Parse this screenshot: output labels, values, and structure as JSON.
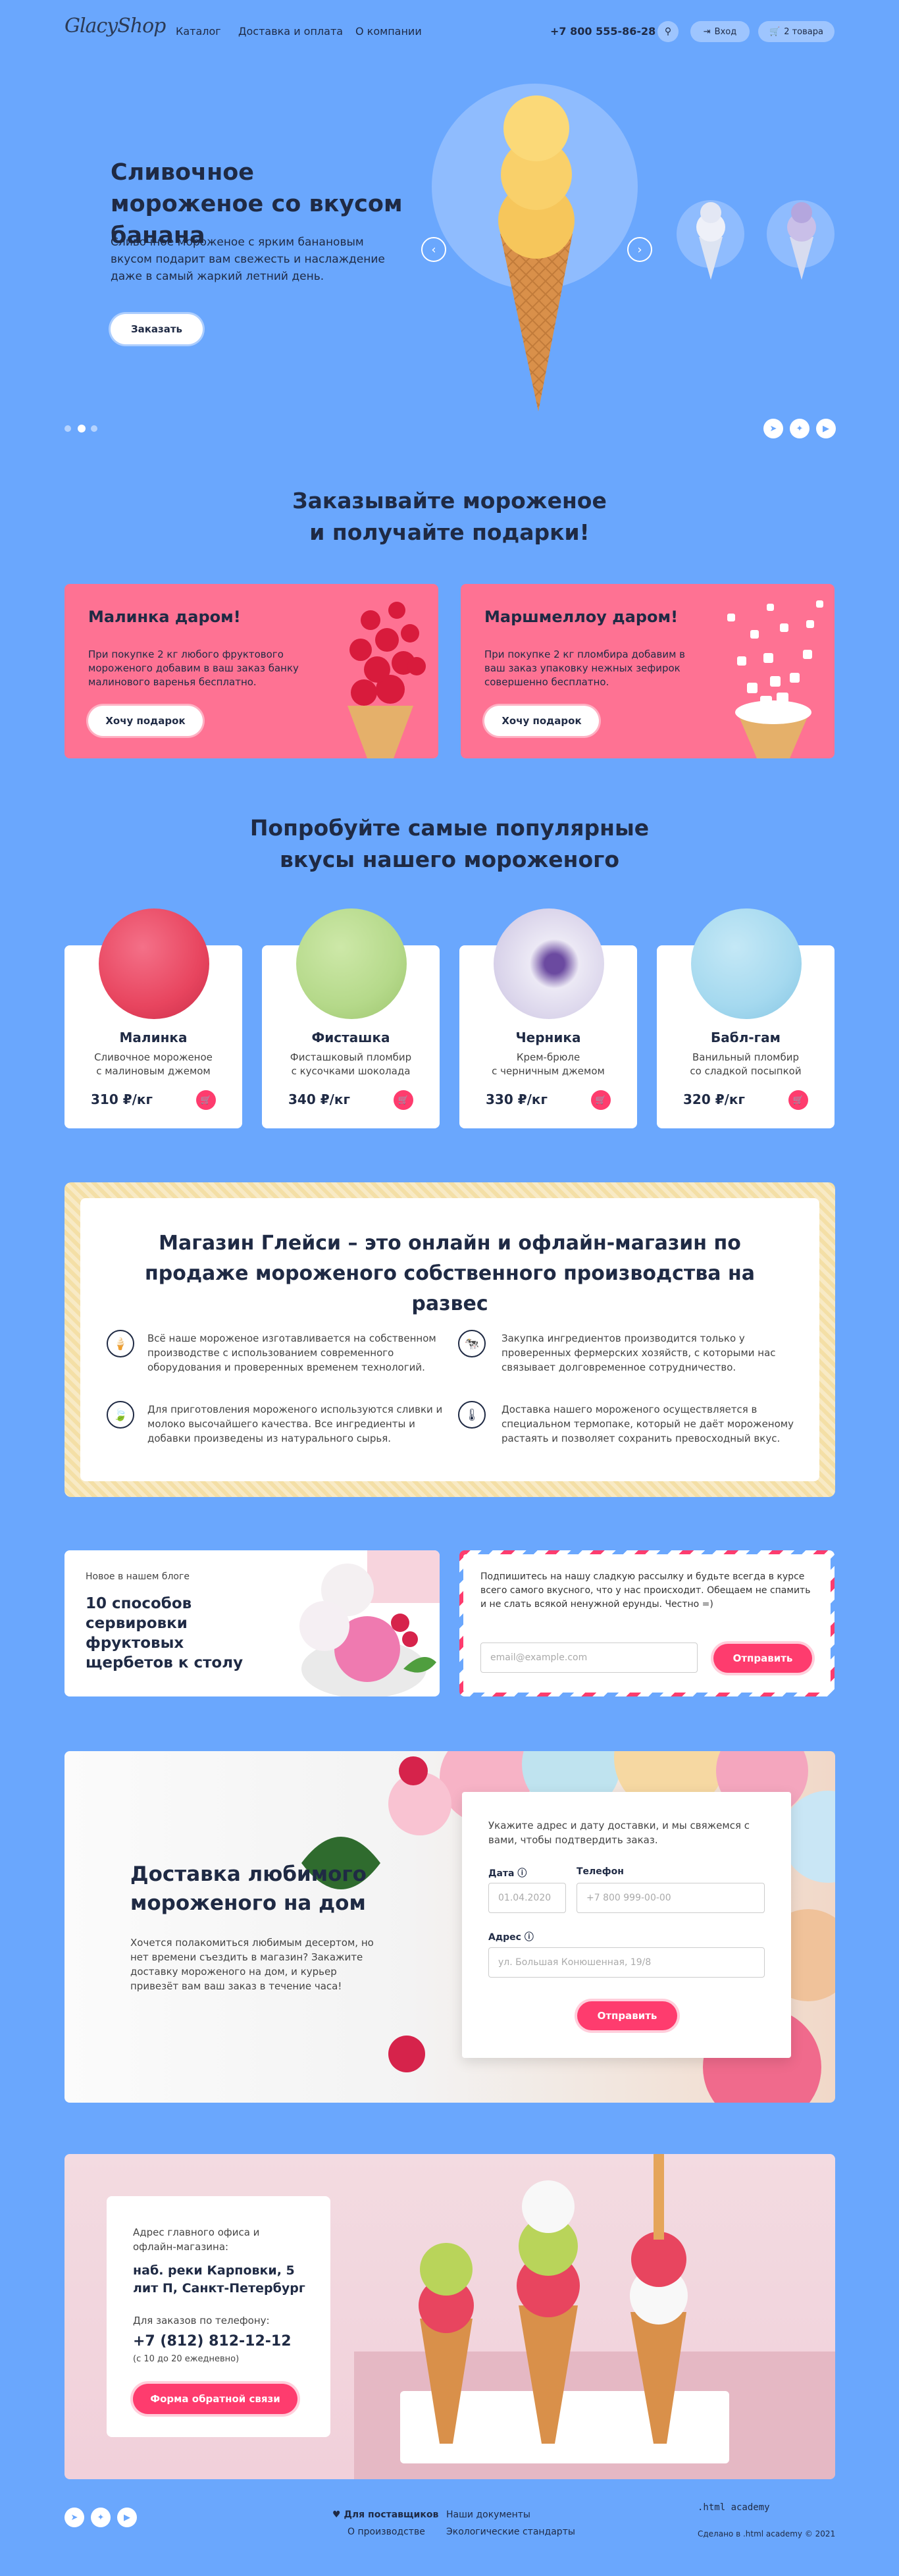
{
  "header": {
    "logo": "GlacyShop",
    "nav": [
      "Каталог",
      "Доставка и оплата",
      "О компании"
    ],
    "phone": "+7 800 555-86-28",
    "login": "Вход",
    "cart": "2 товара"
  },
  "hero": {
    "title": "Сливочное мороженое со вкусом банана",
    "text": "Сливочное мороженое с ярким банановым вкусом подарит вам свежесть и наслаждение даже в самый жаркий летний день.",
    "button": "Заказать",
    "slides_total": 3,
    "slide_active": 2
  },
  "gifts": {
    "title": "Заказывайте мороженое\nи получайте подарки!",
    "items": [
      {
        "title": "Малинка даром!",
        "text": "При покупке 2 кг любого фруктового мороженого добавим в ваш заказ банку малинового варенья бесплатно.",
        "button": "Хочу подарок"
      },
      {
        "title": "Маршмеллоу даром!",
        "text": "При покупке 2 кг пломбира добавим в ваш заказ упаковку нежных зефирок совершенно бесплатно.",
        "button": "Хочу подарок"
      }
    ]
  },
  "popular": {
    "title": "Попробуйте самые популярные\nвкусы нашего мороженого",
    "items": [
      {
        "name": "Малинка",
        "desc": "Сливочное мороженое\nс малиновым джемом",
        "price": "310 ₽/кг",
        "color": "#e8455f"
      },
      {
        "name": "Фисташка",
        "desc": "Фисташковый пломбир\nс кусочками шоколада",
        "price": "340 ₽/кг",
        "color": "#b5d98a"
      },
      {
        "name": "Черника",
        "desc": "Крем-брюле\nс черничным джемом",
        "price": "330 ₽/кг",
        "color": "#ece9f5"
      },
      {
        "name": "Бабл-гам",
        "desc": "Ванильный пломбир\nсо сладкой посыпкой",
        "price": "320 ₽/кг",
        "color": "#a5d9ef"
      }
    ]
  },
  "about": {
    "title": "Магазин Глейси – это онлайн и офлайн-магазин по продаже мороженого собственного производства на развес",
    "features": [
      "Всё наше мороженое изготавливается на собственном производстве с использованием современного оборудования и проверенных временем технологий.",
      "Закупка ингредиентов производится только у проверенных фермерских хозяйств, с которыми нас связывает долговременное сотрудничество.",
      "Для приготовления мороженого используются сливки и молоко высочайшего качества. Все ингредиенты и добавки произведены из натурального сырья.",
      "Доставка нашего мороженого осуществляется в специальном термопаке, который не даёт мороженому растаять и позволяет сохранить превосходный вкус."
    ]
  },
  "blog": {
    "label": "Новое в нашем блоге",
    "title": "10 способов сервировки фруктовых щербетов к столу"
  },
  "subscribe": {
    "text": "Подпишитесь на нашу сладкую рассылку и будьте всегда в курсе всего самого вкусного, что у нас происходит. Обещаем не спамить и не слать всякой ненужной ерунды. Честно =)",
    "placeholder": "email@example.com",
    "button": "Отправить"
  },
  "delivery": {
    "title": "Доставка любимого мороженого на дом",
    "text": "Хочется полакомиться любимым десертом, но нет времени съездить в магазин? Закажите доставку мороженого на дом, и курьер привезёт вам ваш заказ в течение часа!",
    "form_text": "Укажите адрес и дату доставки, и мы свяжемся с вами, чтобы подтвердить заказ.",
    "date_label": "Дата",
    "date_placeholder": "01.04.2020",
    "phone_label": "Телефон",
    "phone_placeholder": "+7 800 999-00-00",
    "address_label": "Адрес",
    "address_placeholder": "ул. Большая Конюшенная, 19/8",
    "button": "Отправить"
  },
  "contacts": {
    "office_label": "Адрес главного офиса и офлайн-магазина:",
    "address": "наб. реки Карповки, 5 лит П, Санкт-Петербург",
    "phone_label": "Для заказов по телефону:",
    "phone": "+7 (812) 812-12-12",
    "hours": "(с 10 до 20 ежедневно)",
    "button": "Форма обратной связи"
  },
  "footer": {
    "suppliers": "Для поставщиков",
    "production": "О производстве",
    "documents": "Наши документы",
    "standards": "Экологические стандарты",
    "academy_logo": ".html academy",
    "made": "Сделано в .html academy © 2021"
  }
}
